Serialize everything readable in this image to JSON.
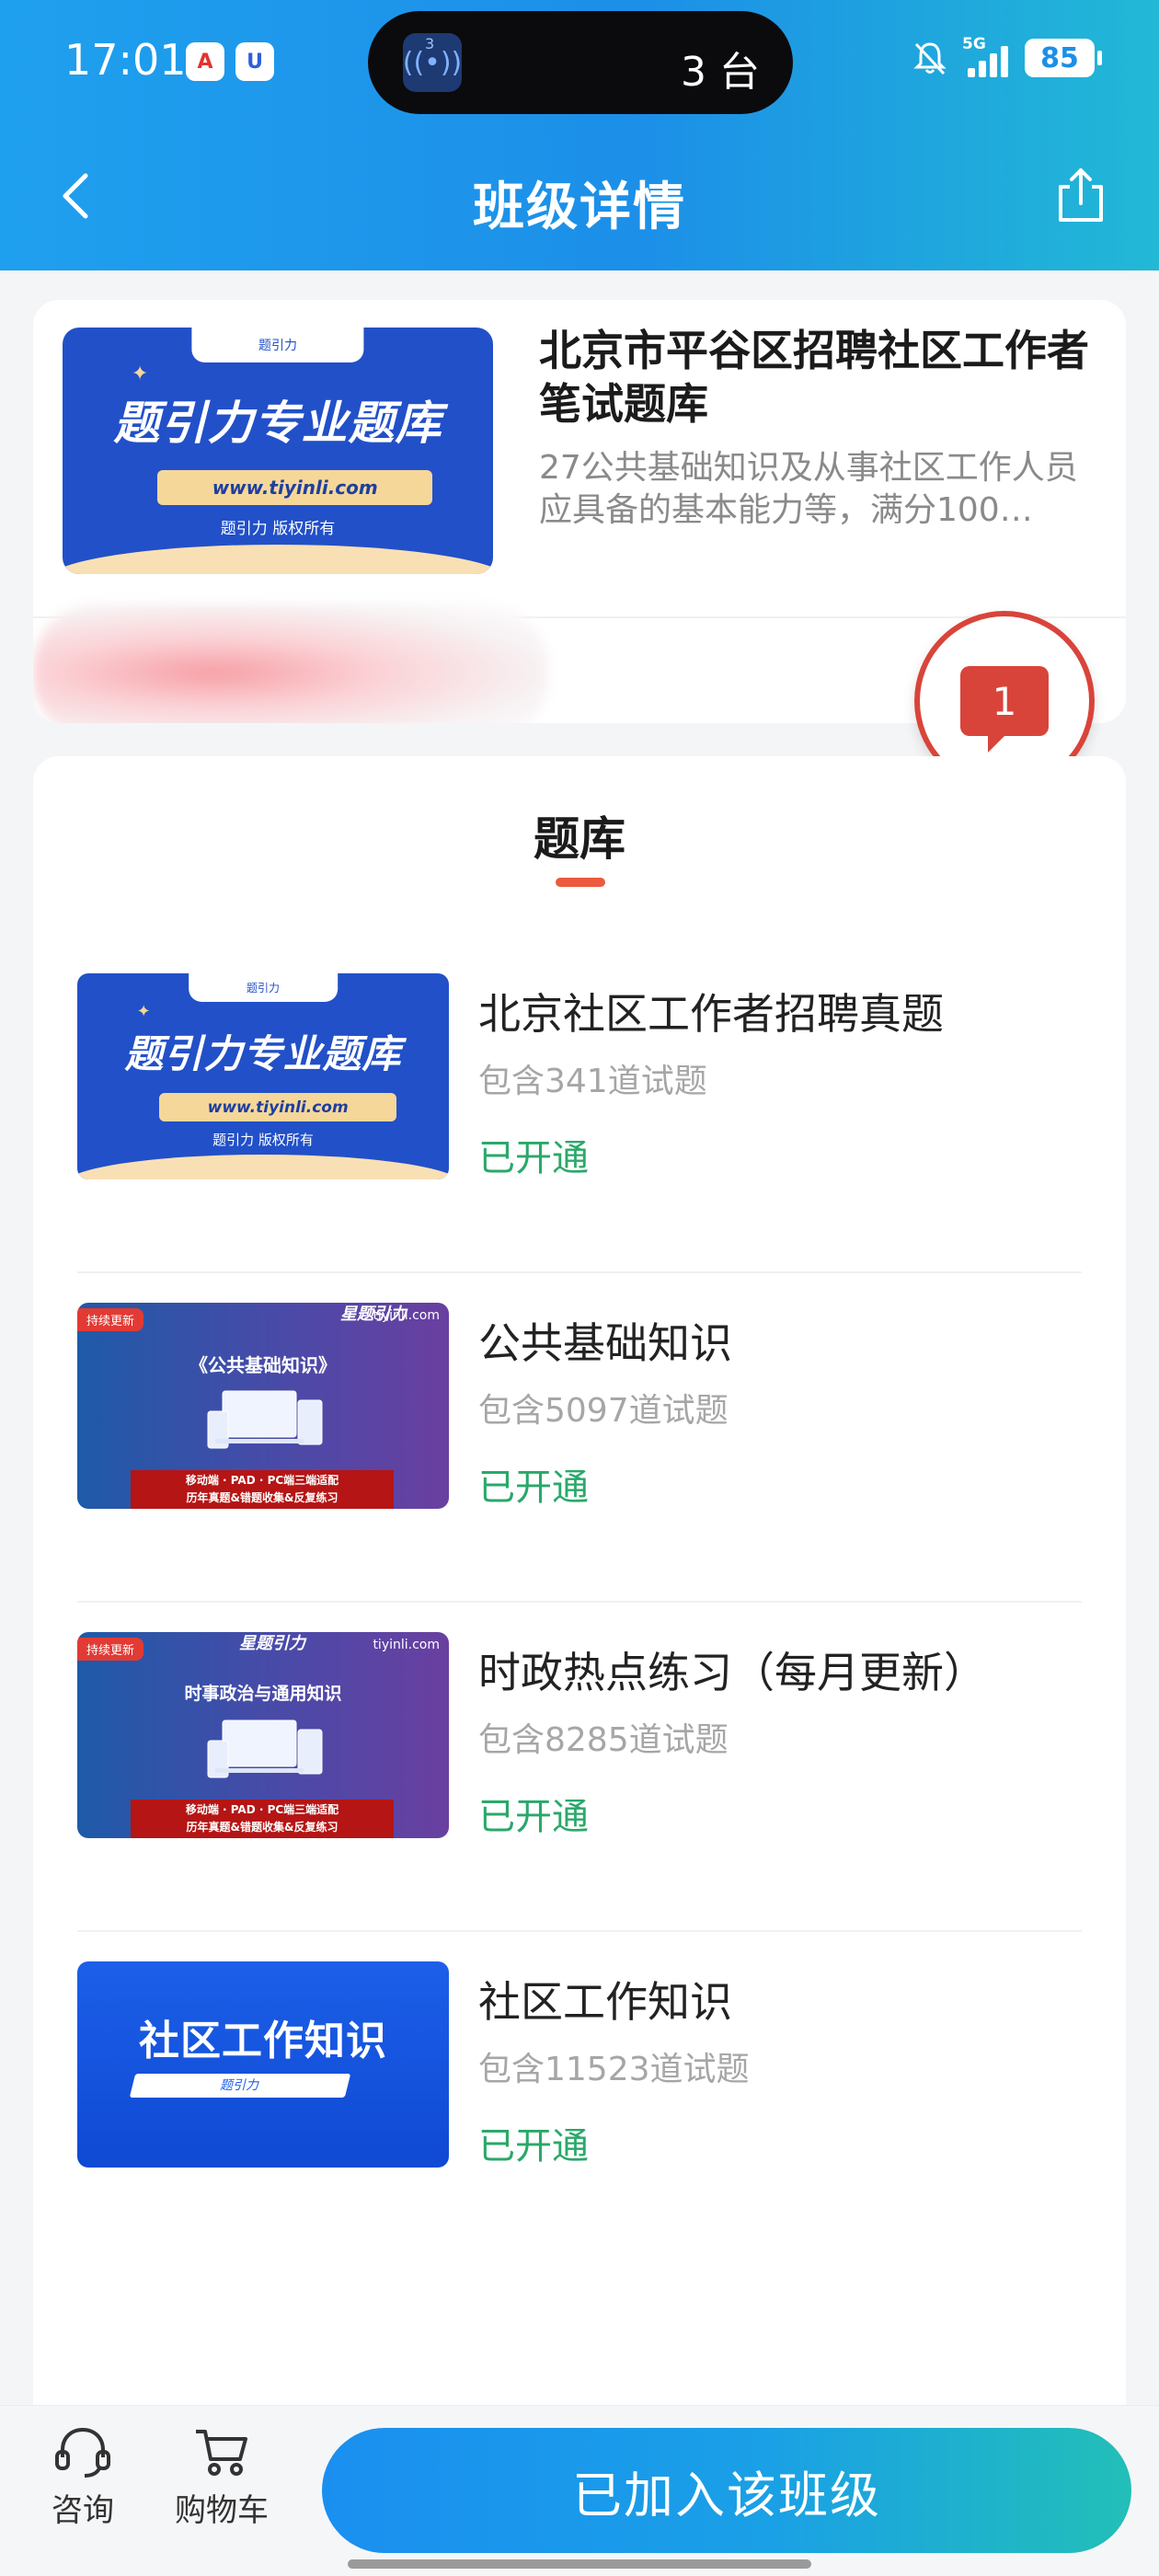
{
  "status_bar": {
    "time": "17:01",
    "island_badge": "3",
    "island_text": "3 台",
    "network": "5G",
    "battery": "85"
  },
  "nav": {
    "title": "班级详情"
  },
  "class_info": {
    "cover": {
      "tab": "题引力",
      "headline": "题引力专业题库",
      "url": "www.tiyinli.com",
      "copyright": "题引力 版权所有"
    },
    "title": "北京市平谷区招聘社区工作者笔试题库",
    "description": "27公共基础知识及从事社区工作人员应具备的基本能力等，满分100…",
    "chat_badge_count": "1"
  },
  "bank": {
    "title": "题库",
    "items": [
      {
        "name": "北京社区工作者招聘真题",
        "count": "包含341道试题",
        "status": "已开通",
        "thumb": {
          "tab": "题引力",
          "headline": "题引力专业题库",
          "url": "www.tiyinli.com",
          "copyright": "题引力 版权所有"
        }
      },
      {
        "name": "公共基础知识",
        "count": "包含5097道试题",
        "status": "已开通",
        "thumb": {
          "tag": "持续更新",
          "logo": "星题引力",
          "site": "tiyinli.com",
          "title": "《公共基础知识》",
          "band_line1": "移动端 · PAD · PC端三端适配",
          "band_line2": "历年真题&错题收集&反复练习"
        }
      },
      {
        "name": "时政热点练习（每月更新）",
        "count": "包含8285道试题",
        "status": "已开通",
        "thumb": {
          "tag": "持续更新",
          "logo": "星题引力",
          "site": "tiyinli.com",
          "title": "时事政治与通用知识",
          "band_line1": "移动端 · PAD · PC端三端适配",
          "band_line2": "历年真题&错题收集&反复练习"
        }
      },
      {
        "name": "社区工作知识",
        "count": "包含11523道试题",
        "status": "已开通",
        "thumb": {
          "title": "社区工作知识",
          "bar": "题引力"
        }
      }
    ]
  },
  "bottom_bar": {
    "consult_label": "咨询",
    "cart_label": "购物车",
    "join_label": "已加入该班级"
  },
  "colors": {
    "header_blue": "#1c8fe8",
    "status_green": "#2aa86a",
    "accent_red": "#d9443a",
    "underline_orange": "#ec5a3f"
  }
}
